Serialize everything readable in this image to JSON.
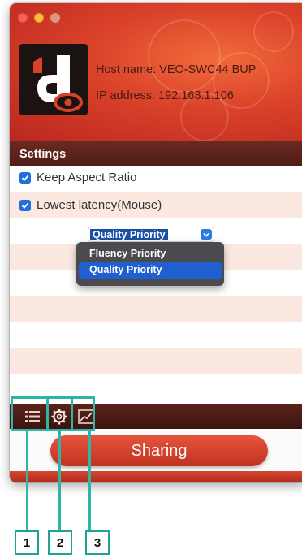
{
  "window": {
    "host_label": "Host name: ",
    "host_value": "VEO-SWC44 BUP",
    "ip_label": "IP address: ",
    "ip_value": "192.168.1.106"
  },
  "settings": {
    "title": "Settings",
    "keep_aspect_ratio": {
      "label": "Keep Aspect Ratio",
      "checked": true
    },
    "lowest_latency": {
      "label": "Lowest latency(Mouse)",
      "checked": true
    },
    "priority_select": {
      "selected": "Quality Priority",
      "options": [
        "Fluency Priority",
        "Quality Priority"
      ]
    }
  },
  "toolbar": {
    "icons": [
      "list-icon",
      "gear-icon",
      "chart-icon"
    ]
  },
  "sharing_button": "Sharing",
  "callouts": [
    "1",
    "2",
    "3"
  ],
  "colors": {
    "brand_red": "#d9412a",
    "callout_teal": "#2fb5a5",
    "checkbox_blue": "#1f6fde"
  }
}
